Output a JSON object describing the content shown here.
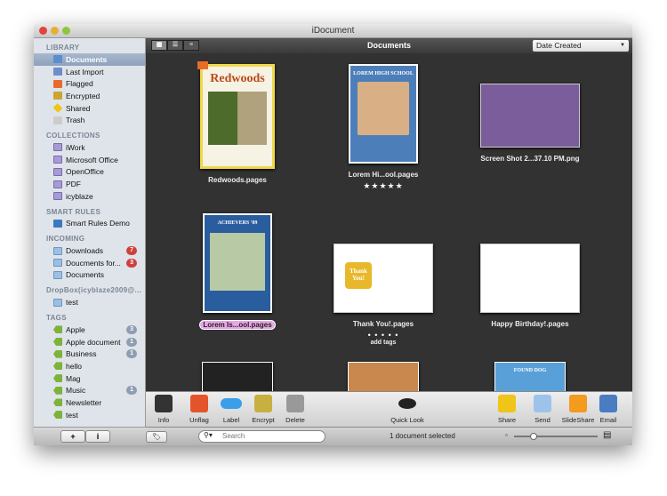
{
  "window": {
    "title": "iDocument"
  },
  "sidebar": {
    "library": {
      "title": "LIBRARY",
      "items": [
        {
          "label": "Documents"
        },
        {
          "label": "Last Import"
        },
        {
          "label": "Flagged"
        },
        {
          "label": "Encrypted"
        },
        {
          "label": "Shared"
        },
        {
          "label": "Trash"
        }
      ]
    },
    "collections": {
      "title": "COLLECTIONS",
      "items": [
        {
          "label": "iWork"
        },
        {
          "label": "Microsoft Office"
        },
        {
          "label": "OpenOffice"
        },
        {
          "label": "PDF"
        },
        {
          "label": "icyblaze"
        }
      ]
    },
    "smart_rules": {
      "title": "SMART RULES",
      "items": [
        {
          "label": "Smart Rules Demo"
        }
      ]
    },
    "incoming": {
      "title": "INCOMING",
      "items": [
        {
          "label": "Downloads",
          "badge": "7"
        },
        {
          "label": "Doucments for...",
          "badge": "3"
        },
        {
          "label": "Documents"
        }
      ]
    },
    "dropbox": {
      "title": "DropBox(icyblaze2009@...",
      "items": [
        {
          "label": "test"
        }
      ]
    },
    "tags": {
      "title": "TAGS",
      "items": [
        {
          "label": "Apple",
          "badge": "3"
        },
        {
          "label": "Apple document",
          "badge": "1"
        },
        {
          "label": "Business",
          "badge": "1"
        },
        {
          "label": "hello"
        },
        {
          "label": "Mag"
        },
        {
          "label": "Music",
          "badge": "1"
        },
        {
          "label": "Newsletter"
        },
        {
          "label": "test"
        }
      ]
    },
    "add_label": "+",
    "info_label": "i"
  },
  "header": {
    "title": "Documents",
    "sort": "Date Created"
  },
  "documents": [
    {
      "name": "Redwoods.pages",
      "thumb_title": "Redwoods"
    },
    {
      "name": "Lorem Hi...ool.pages",
      "rating": "★★★★★",
      "thumb_title": "LOREM HIGH SCHOOL"
    },
    {
      "name": "Screen Shot 2...37.10 PM.png"
    },
    {
      "name": "Lorem Is...ool.pages",
      "thumb_title": "ACHIEVERS '09"
    },
    {
      "name": "Thank You!.pages",
      "rating": "• • • • •",
      "tags": "add tags",
      "thumb_title": "Thank You!"
    },
    {
      "name": "Happy Birthday!.pages"
    },
    {
      "name": ""
    },
    {
      "name": ""
    },
    {
      "name": "",
      "thumb_title": "FOUND DOG"
    }
  ],
  "toolbar": {
    "info": "Info",
    "unflag": "Unflag",
    "label": "Label",
    "encrypt": "Encrypt",
    "delete": "Delete",
    "quicklook": "Quick Look",
    "share": "Share",
    "send": "Send",
    "slideshare": "SlideShare",
    "email": "Email"
  },
  "status": {
    "search_placeholder": "Search",
    "selection": "1 document selected",
    "zoom_level": 0.2
  },
  "colors": {
    "selected_label": "#e9a6e6",
    "tag_green": "#7db33b",
    "badge_red": "#d0403b"
  }
}
